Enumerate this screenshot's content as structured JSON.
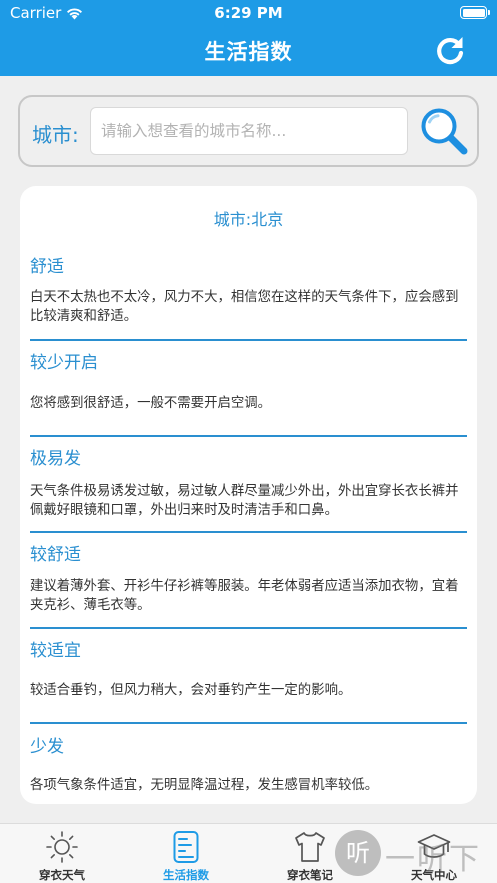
{
  "status_bar": {
    "carrier": "Carrier",
    "time": "6:29 PM"
  },
  "nav": {
    "title": "生活指数",
    "refresh_icon": "refresh-icon"
  },
  "search": {
    "label": "城市:",
    "placeholder": "请输入想查看的城市名称...",
    "value": "",
    "search_icon": "search-icon"
  },
  "card": {
    "city_label": "城市:北京",
    "sections": [
      {
        "title": "舒适",
        "desc": "白天不太热也不太冷，风力不大，相信您在这样的天气条件下，应会感到比较清爽和舒适。"
      },
      {
        "title": "较少开启",
        "desc": "您将感到很舒适，一般不需要开启空调。"
      },
      {
        "title": "极易发",
        "desc": "天气条件极易诱发过敏，易过敏人群尽量减少外出，外出宜穿长衣长裤并佩戴好眼镜和口罩，外出归来时及时清洁手和口鼻。"
      },
      {
        "title": "较舒适",
        "desc": "建议着薄外套、开衫牛仔衫裤等服装。年老体弱者应适当添加衣物，宜着夹克衫、薄毛衣等。"
      },
      {
        "title": "较适宜",
        "desc": "较适合垂钓，但风力稍大，会对垂钓产生一定的影响。"
      },
      {
        "title": "少发",
        "desc": "各项气象条件适宜，无明显降温过程，发生感冒机率较低。"
      }
    ]
  },
  "tabbar": {
    "items": [
      {
        "label": "穿衣天气",
        "icon": "sun-icon",
        "active": false
      },
      {
        "label": "生活指数",
        "icon": "document-icon",
        "active": true
      },
      {
        "label": "穿衣笔记",
        "icon": "tshirt-icon",
        "active": false
      },
      {
        "label": "天气中心",
        "icon": "graduation-cap-icon",
        "active": false
      }
    ]
  },
  "watermark": {
    "glyph": "听",
    "text": "一听下载"
  },
  "colors": {
    "brand": "#1e9be6",
    "accent_text": "#2a8fd0",
    "background": "#efefef"
  }
}
